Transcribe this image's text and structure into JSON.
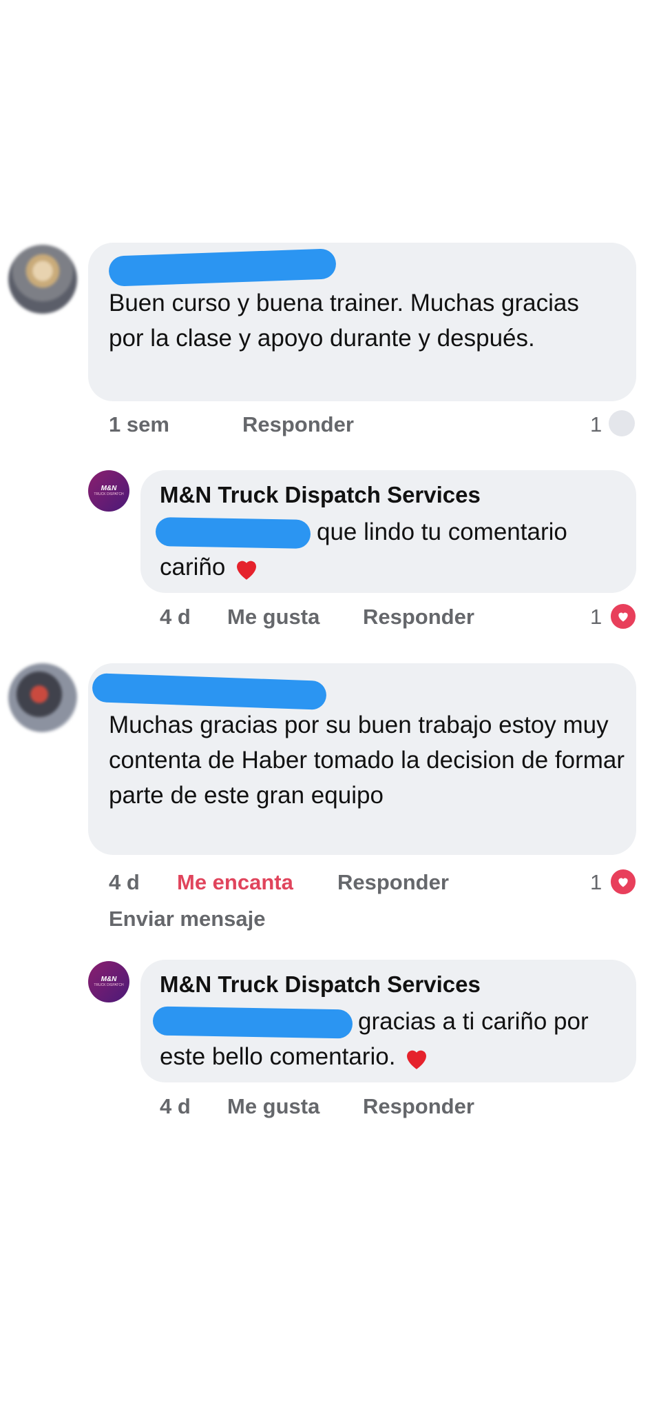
{
  "comments": [
    {
      "text": "Buen curso y buena trainer. Muchas gracias por la clase y apoyo durante y después.",
      "time": "1 sem",
      "reply_label": "Responder",
      "reaction_count": "1"
    },
    {
      "author": "M&N Truck Dispatch  Services",
      "text": "que lindo tu comentario cariño",
      "time": "4 d",
      "like_label": "Me gusta",
      "reply_label": "Responder",
      "reaction_count": "1",
      "logo_text": "M&N",
      "logo_sub": "TRUCK DISPATCH"
    },
    {
      "text": "Muchas gracias por su buen trabajo estoy muy contenta de Haber tomado la decision de formar parte de este gran equipo",
      "time": "4 d",
      "reaction_label": "Me encanta",
      "reply_label": "Responder",
      "reaction_count": "1",
      "send_message_label": "Enviar mensaje"
    },
    {
      "author": "M&N Truck Dispatch  Services",
      "text": "gracias a ti cariño por este bello comentario.",
      "time": "4 d",
      "like_label": "Me gusta",
      "reply_label": "Responder",
      "logo_text": "M&N",
      "logo_sub": "TRUCK DISPATCH"
    }
  ],
  "colors": {
    "bubble": "#eef0f3",
    "love": "#e0445c",
    "meta": "#65676b"
  },
  "icons": {
    "heart": "heart-emoji-icon",
    "love_reaction": "love-reaction-icon"
  }
}
